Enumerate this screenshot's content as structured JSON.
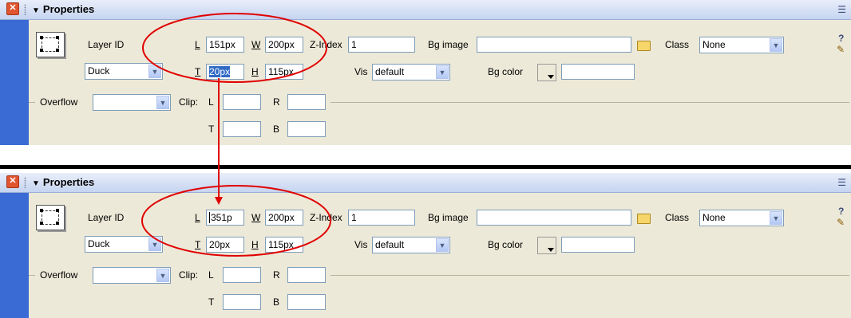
{
  "panels": [
    {
      "title": "Properties",
      "layer_id_label": "Layer ID",
      "layer_id_value": "Duck",
      "l_label": "L",
      "l_value": "151px",
      "w_label": "W",
      "w_value": "200px",
      "t_label": "T",
      "t_value": "20px",
      "h_label": "H",
      "h_value": "115px",
      "zindex_label": "Z-Index",
      "zindex_value": "1",
      "vis_label": "Vis",
      "vis_value": "default",
      "bgimage_label": "Bg image",
      "bgimage_value": "",
      "bgcolor_label": "Bg color",
      "bgcolor_value": "",
      "class_label": "Class",
      "class_value": "None",
      "overflow_label": "Overflow",
      "overflow_value": "",
      "clip_label": "Clip:",
      "clip_l_label": "L",
      "clip_r_label": "R",
      "clip_t_label": "T",
      "clip_b_label": "B",
      "help_label": "?"
    },
    {
      "title": "Properties",
      "layer_id_label": "Layer ID",
      "layer_id_value": "Duck",
      "l_label": "L",
      "l_value": "351p",
      "w_label": "W",
      "w_value": "200px",
      "t_label": "T",
      "t_value": "20px",
      "h_label": "H",
      "h_value": "115px",
      "zindex_label": "Z-Index",
      "zindex_value": "1",
      "vis_label": "Vis",
      "vis_value": "default",
      "bgimage_label": "Bg image",
      "bgimage_value": "",
      "bgcolor_label": "Bg color",
      "bgcolor_value": "",
      "class_label": "Class",
      "class_value": "None",
      "overflow_label": "Overflow",
      "overflow_value": "",
      "clip_label": "Clip:",
      "clip_l_label": "L",
      "clip_r_label": "R",
      "clip_t_label": "T",
      "clip_b_label": "B",
      "help_label": "?"
    }
  ],
  "annotation": {
    "color": "#e00000",
    "shapes": [
      "ellipse-top",
      "ellipse-bottom",
      "arrow-down"
    ]
  }
}
